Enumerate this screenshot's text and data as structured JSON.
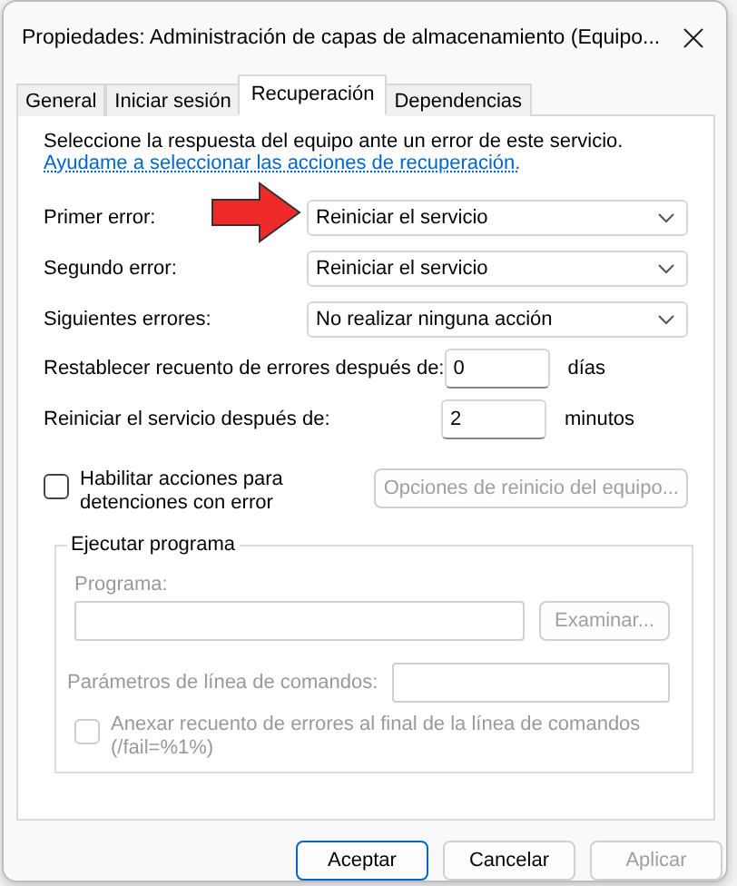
{
  "window": {
    "title": "Propiedades: Administración de capas de almacenamiento (Equipo..."
  },
  "tabs": [
    {
      "label": "General",
      "selected": false
    },
    {
      "label": "Iniciar sesión",
      "selected": false
    },
    {
      "label": "Recuperación",
      "selected": true
    },
    {
      "label": "Dependencias",
      "selected": false
    }
  ],
  "intro": "Seleccione la respuesta del equipo ante un error de este servicio.",
  "help_link": "Ayudame a seleccionar las acciones de recuperación.",
  "failure_actions": [
    {
      "label": "Primer error:",
      "value": "Reiniciar el servicio",
      "highlighted": true
    },
    {
      "label": "Segundo error:",
      "value": "Reiniciar el servicio",
      "highlighted": false
    },
    {
      "label": "Siguientes errores:",
      "value": "No realizar ninguna acción",
      "highlighted": false
    }
  ],
  "numeric_settings": [
    {
      "label": "Restablecer recuento de errores después de:",
      "value": "0",
      "unit": "días"
    },
    {
      "label": "Reiniciar el servicio después de:",
      "value": "2",
      "unit": "minutos"
    }
  ],
  "stop_actions": {
    "label": "Habilitar acciones para detenciones con error",
    "checked": false
  },
  "restart_options_button": {
    "label": "Opciones de reinicio del equipo...",
    "disabled": true
  },
  "run_program": {
    "title": "Ejecutar programa",
    "disabled": true,
    "program_label": "Programa:",
    "browse_button": "Examinar...",
    "params_label": "Parámetros de línea de comandos:",
    "append_label": "Anexar recuento de errores al final de la línea de comandos (/fail=%1%)",
    "append_checked": false
  },
  "buttons": [
    {
      "label": "Aceptar",
      "default": true,
      "disabled": false
    },
    {
      "label": "Cancelar",
      "default": false,
      "disabled": false
    },
    {
      "label": "Aplicar",
      "default": false,
      "disabled": true
    }
  ]
}
